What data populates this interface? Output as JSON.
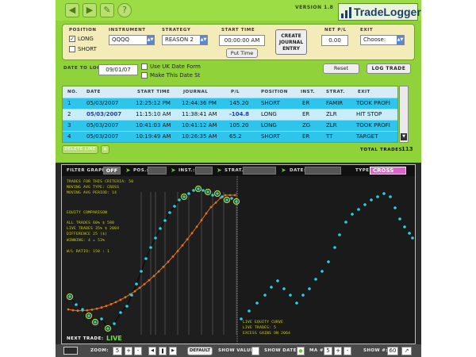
{
  "app": {
    "version": "VERSION 1.8",
    "logo": "TradeLogger"
  },
  "toolbar": {
    "icons": [
      "back-icon",
      "forward-icon",
      "edit-icon",
      "help-icon"
    ]
  },
  "entry": {
    "position_label": "POSITION",
    "long_label": "LONG",
    "short_label": "SHORT",
    "long_checked": true,
    "instrument_label": "INSTRUMENT",
    "instrument_value": "QQQQ",
    "strategy_label": "STRATEGY",
    "strategy_value": "REASON 2",
    "start_time_label": "START TIME",
    "start_time_value": "00:00:00 AM",
    "put_time_label": "Put Time",
    "create_entry_line1": "CREATE",
    "create_entry_line2": "JOURNAL",
    "create_entry_line3": "ENTRY",
    "net_pl_label": "NET P/L",
    "net_pl_value": "0.00",
    "exit_label": "EXIT",
    "exit_value": "Choose:"
  },
  "date_row": {
    "date_label": "DATE TO LOG:",
    "date_value": "09/01/07",
    "uk_date_label": "Use UK Date Form",
    "make_default_label": "Make This Date St",
    "reset_label": "Reset",
    "log_trade_label": "LOG TRADE"
  },
  "table": {
    "columns": [
      "NO.",
      "DATE",
      "START TIME",
      "JOURNAL",
      "P/L",
      "POSITION",
      "INST.",
      "STRAT.",
      "EXIT"
    ],
    "rows": [
      [
        "1",
        "05/03/2007",
        "12:25:12 PM",
        "12:44:36 PM",
        "145.20",
        "SHORT",
        "ER",
        "FAMIR",
        "TOOK PROFI"
      ],
      [
        "2",
        "05/03/2007",
        "11:15:10 AM",
        "11:38:41 AM",
        "-104.8",
        "LONG",
        "ER",
        "ZLR",
        "HIT STOP"
      ],
      [
        "3",
        "05/03/2007",
        "10:41:03 AM",
        "10:41:12 AM",
        "105.20",
        "LONG",
        "ZG",
        "ZLR",
        "TOOK PROFI"
      ],
      [
        "4",
        "05/03/2007",
        "10:19:49 AM",
        "10:26:35 AM",
        "65.2",
        "SHORT",
        "ER",
        "TT",
        "TARGET"
      ]
    ],
    "delete_label": "DELETE LINE",
    "total_label": "TOTAL TRADES:",
    "total_value": "113"
  },
  "filter": {
    "filter_label": "FILTER GRAPH:",
    "filter_value": "OFF",
    "pos_label": "POS.:",
    "inst_label": "INST.:",
    "strat_label": "STRAT.:",
    "date_label": "DATE:",
    "type_label": "TYPE:",
    "type_value": "CROSS"
  },
  "annotations": {
    "l1": "TRADES FOR THIS CRITERIA: 50",
    "l2": "MOVING AVG TYPE: CROSS",
    "l3": "MOVING AVG PERIOD: 14",
    "l4": "EQUITY COMPARISON",
    "l5": "ALL TRADES 60% $ 580",
    "l6": "LIVE TRADES 35% $ 2084",
    "l7": "DIFFERENCE 25 ($)",
    "l8": "WINNING: 4 = 53%",
    "l9": "W/L RATIO: 150 : 1",
    "live_curve1": "LIVE EQUITY CURVE",
    "live_curve2": "LIVE TRADES: 5",
    "live_curve3": "EXCESS GAINS ON 2064"
  },
  "graph": {
    "next_trade_label": "NEXT TRADE:",
    "next_trade_value": "LIVE",
    "colors": {
      "equity": "#28d0e8",
      "moving_avg": "#e8701c",
      "highlight": "#b8e030"
    }
  },
  "bottom": {
    "zoom_label": "ZOOM:",
    "zoom_value": "5",
    "default_label": "DEFAULT",
    "show_values_label": "SHOW VALUES:",
    "show_dates_label": "SHOW DATES:",
    "ma_label": "MA #:",
    "ma_value": "5",
    "show_label": "SHOW #:",
    "show_value": "60"
  }
}
